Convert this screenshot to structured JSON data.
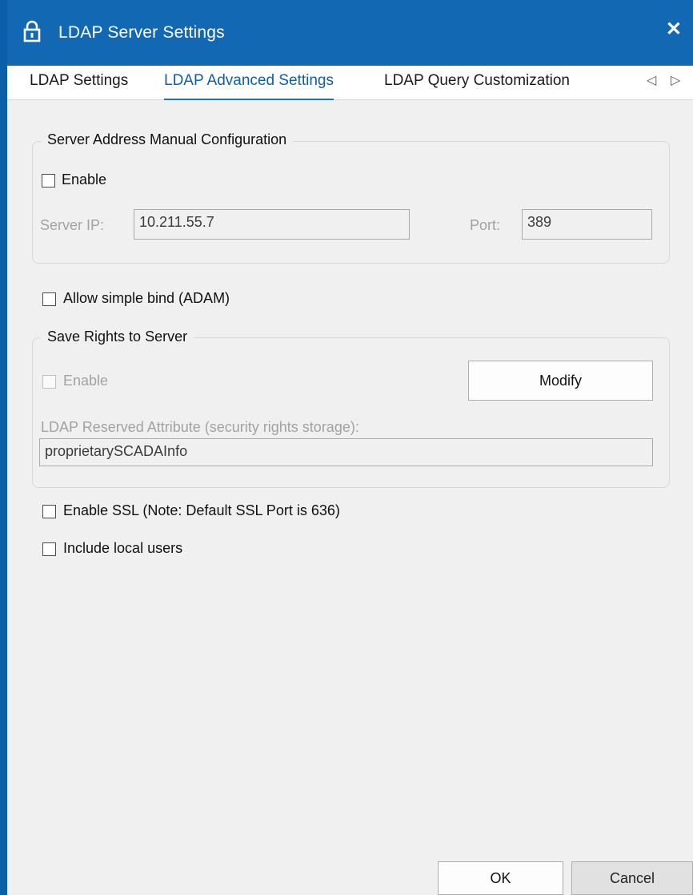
{
  "window": {
    "title": "LDAP Server Settings",
    "close_glyph": "✕",
    "lock_icon": "lock-icon"
  },
  "tabs": {
    "items": [
      {
        "label": "LDAP Settings",
        "active": false
      },
      {
        "label": "LDAP Advanced Settings",
        "active": true
      },
      {
        "label": "LDAP Query Customization",
        "active": false
      }
    ],
    "prev_glyph": "◁",
    "next_glyph": "▷"
  },
  "server_address": {
    "legend": "Server Address Manual Configuration",
    "enable_label": "Enable",
    "enable_checked": false,
    "ip_label": "Server IP:",
    "ip_value": "10.211.55.7",
    "port_label": "Port:",
    "port_value": "389"
  },
  "simple_bind": {
    "label": "Allow simple bind (ADAM)",
    "checked": false
  },
  "save_rights": {
    "legend": "Save Rights to Server",
    "enable_label": "Enable",
    "enable_checked": false,
    "modify_label": "Modify",
    "attr_label": "LDAP Reserved Attribute (security rights storage):",
    "attr_value": "proprietarySCADAInfo"
  },
  "ssl": {
    "label": "Enable SSL (Note: Default SSL Port is 636)",
    "checked": false
  },
  "local_users": {
    "label": "Include local users",
    "checked": false
  },
  "footer": {
    "ok_label": "OK",
    "cancel_label": "Cancel"
  },
  "colors": {
    "titlebar": "#1268b3",
    "accent": "#1c74c6",
    "panel": "#f0f0f0"
  }
}
